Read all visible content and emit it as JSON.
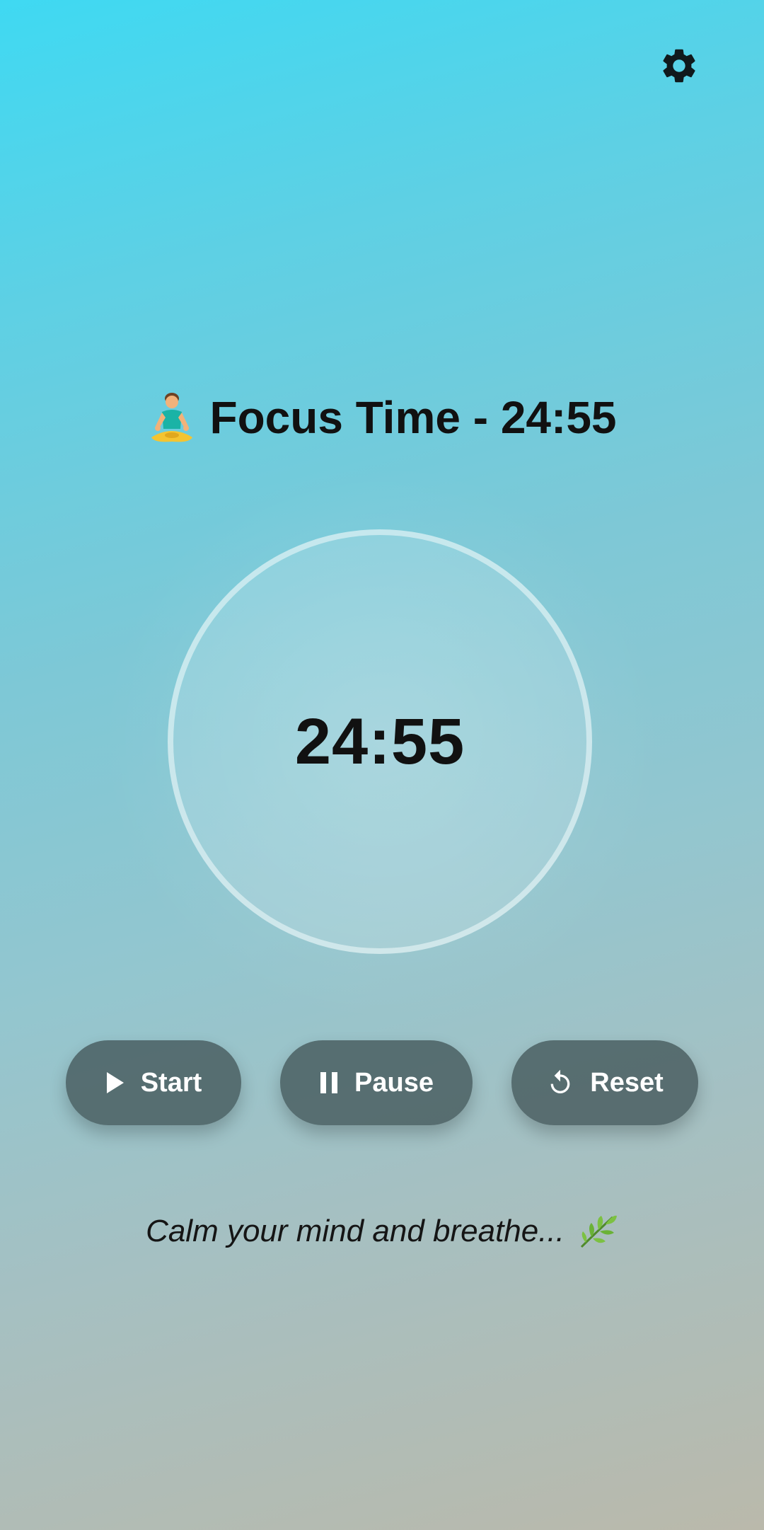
{
  "header": {
    "title_emoji": "meditation-person-icon",
    "title": "Focus Time - 24:55",
    "settings_icon": "gear-icon"
  },
  "timer": {
    "display": "24:55"
  },
  "controls": {
    "start_label": "Start",
    "pause_label": "Pause",
    "reset_label": "Reset"
  },
  "footer": {
    "tagline": "Calm your mind and breathe...",
    "tagline_icon": "herb-leaf-icon"
  },
  "colors": {
    "background_top": "#3fd9f2",
    "background_bottom": "#bab9ab",
    "button_bg": "#425658",
    "text": "#111111"
  }
}
